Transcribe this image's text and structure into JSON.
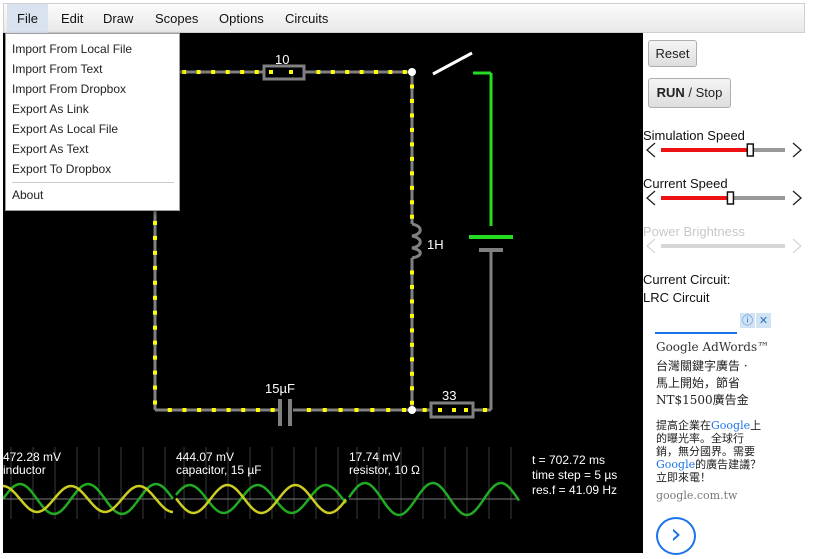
{
  "menu": {
    "file": "File",
    "edit": "Edit",
    "draw": "Draw",
    "scopes": "Scopes",
    "options": "Options",
    "circuits": "Circuits"
  },
  "file_menu": {
    "items": [
      "Import From Local File",
      "Import From Text",
      "Import From Dropbox",
      "Export As Link",
      "Export As Local File",
      "Export As Text",
      "Export To Dropbox"
    ],
    "about": "About"
  },
  "circuit": {
    "resistor_top_label": "10",
    "inductor_label": "1H",
    "capacitor_label": "15µF",
    "resistor_bottom_label": "33"
  },
  "scopes": [
    {
      "value": "472.28 mV",
      "name": "inductor"
    },
    {
      "value": "444.07 mV",
      "name": "capacitor, 15 µF"
    },
    {
      "value": "17.74 mV",
      "name": "resistor, 10 Ω"
    }
  ],
  "sim_info": {
    "time": "t = 702.72 ms",
    "time_step": "time step = 5 µs",
    "res_freq": "res.f = 41.09 Hz"
  },
  "panel": {
    "reset": "Reset",
    "run": "RUN",
    "stop": "/ Stop",
    "simulation_speed": "Simulation Speed",
    "current_speed": "Current Speed",
    "power_brightness": "Power Brightness",
    "current_circuit_label": "Current Circuit:",
    "current_circuit_name": "LRC Circuit",
    "simulation_speed_level": 0.72,
    "current_speed_level": 0.56
  },
  "ad": {
    "brand": "Google AdWords™",
    "line1": "台灣關鍵字廣告 ·",
    "line2": "馬上開始，節省",
    "line3": "NT$1500廣告金",
    "body1a": "提高企業在",
    "body1b": "Google",
    "body1c": "上",
    "body2": "的曝光率。全球行",
    "body3": "銷，無分國界。需要",
    "body4a": "Google",
    "body4b": "的廣告建議？",
    "body5": "立即來電！",
    "domain": "google.com.tw",
    "info_icon": "ⓘ",
    "close_icon": "✕",
    "arrow_icon": "›"
  },
  "colors": {
    "wire": "#808080",
    "current_dot": "#ffff00",
    "green": "#22dd22",
    "red": "#ee1111",
    "scope_green": "#22aa22",
    "scope_yellow": "#cccc22",
    "link_blue": "#1a73e8"
  }
}
